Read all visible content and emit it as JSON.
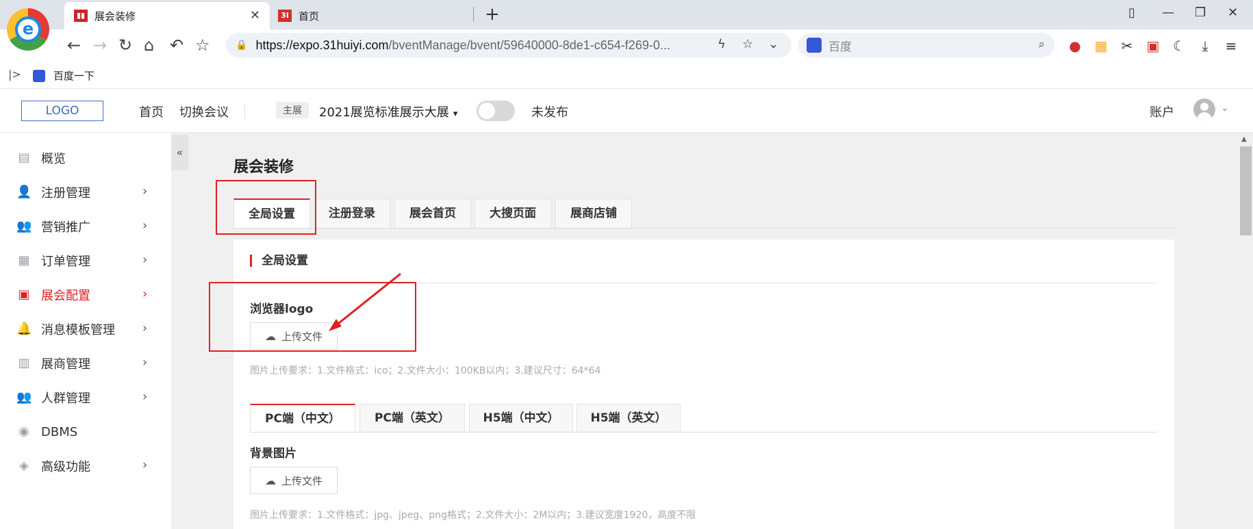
{
  "browser": {
    "logo_letter": "e",
    "tabs": [
      {
        "title": "展会装修",
        "favicon": "chart-icon",
        "active": true
      },
      {
        "title": "首页",
        "favicon": "31-logo-icon",
        "favicon_text": "3I",
        "active": false
      }
    ],
    "close_glyph": "✕",
    "new_tab_glyph": "+",
    "url": {
      "domain": "https://expo.31huiyi.com",
      "path": "/bventManage/bvent/59640000-8de1-c654-f269-0..."
    },
    "search": {
      "engine_glyph": "🐾",
      "placeholder": "百度"
    },
    "bookmarks": [
      {
        "label": "百度一下",
        "icon": "baidu-paw-icon",
        "glyph": "🐾"
      }
    ],
    "bm_toggle_glyph": "|>"
  },
  "app": {
    "logo": "LOGO",
    "nav": {
      "home": "首页",
      "switch": "切换会议"
    },
    "event_tag": "主展",
    "event_name": "2021展览标准展示大展",
    "publish_status": "未发布",
    "account": "账户"
  },
  "sidebar": {
    "collapse_glyph": "«",
    "items": [
      {
        "label": "概览",
        "icon": "dashboard-icon",
        "glyph": "▤",
        "has_arrow": false,
        "active": false
      },
      {
        "label": "注册管理",
        "icon": "user-register-icon",
        "glyph": "👤",
        "has_arrow": true,
        "active": false
      },
      {
        "label": "营销推广",
        "icon": "group-icon",
        "glyph": "👥",
        "has_arrow": true,
        "active": false
      },
      {
        "label": "订单管理",
        "icon": "order-icon",
        "glyph": "▦",
        "has_arrow": true,
        "active": false
      },
      {
        "label": "展会配置",
        "icon": "screen-config-icon",
        "glyph": "▣",
        "has_arrow": true,
        "active": true
      },
      {
        "label": "消息模板管理",
        "icon": "bell-icon",
        "glyph": "🔔",
        "has_arrow": true,
        "active": false
      },
      {
        "label": "展商管理",
        "icon": "store-icon",
        "glyph": "▥",
        "has_arrow": true,
        "active": false
      },
      {
        "label": "人群管理",
        "icon": "people-icon",
        "glyph": "👥",
        "has_arrow": true,
        "active": false
      },
      {
        "label": "DBMS",
        "icon": "database-icon",
        "glyph": "◉",
        "has_arrow": false,
        "active": false
      },
      {
        "label": "高级功能",
        "icon": "tag-icon",
        "glyph": "◈",
        "has_arrow": true,
        "active": false
      }
    ],
    "arrow_glyph": "›"
  },
  "main": {
    "title": "展会装修",
    "tabs": [
      "全局设置",
      "注册登录",
      "展会首页",
      "大搜页面",
      "展商店铺"
    ],
    "section_title": "全局设置",
    "browser_logo_label": "浏览器logo",
    "upload_label": "上传文件",
    "browser_logo_hint": "图片上传要求：1.文件格式：ico；2.文件大小：100KB以内；3.建议尺寸：64*64",
    "sub_tabs": [
      "PC端（中文）",
      "PC端（英文）",
      "H5端（中文）",
      "H5端（英文）"
    ],
    "bg_label": "背景图片",
    "bg_hint": "图片上传要求：1.文件格式：jpg、jpeg、png格式；2.文件大小：2M以内；3.建议宽度1920，高度不限"
  },
  "colors": {
    "accent": "#e02020",
    "annotation": "#e02020"
  }
}
